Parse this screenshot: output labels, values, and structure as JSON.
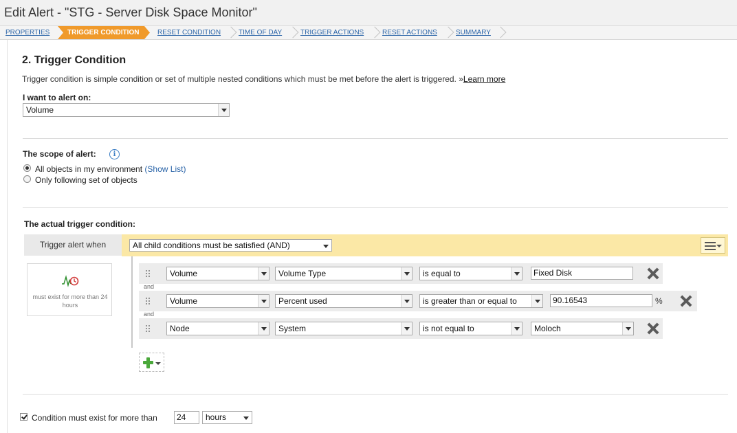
{
  "page_title": "Edit Alert - \"STG - Server Disk Space Monitor\"",
  "wizard_steps": [
    {
      "label": "PROPERTIES"
    },
    {
      "label": "TRIGGER CONDITION",
      "active": true
    },
    {
      "label": "RESET CONDITION"
    },
    {
      "label": "TIME OF DAY"
    },
    {
      "label": "TRIGGER ACTIONS"
    },
    {
      "label": "RESET ACTIONS"
    },
    {
      "label": "SUMMARY"
    }
  ],
  "section": {
    "title": "2. Trigger Condition",
    "description": "Trigger condition is simple condition or set of multiple nested conditions which must be met before the alert is triggered. »",
    "learn_more": "Learn more"
  },
  "alert_on": {
    "label": "I want to alert on:",
    "value": "Volume"
  },
  "scope": {
    "label": "The scope of alert:",
    "option_all": "All objects in my environment",
    "show_list": "(Show List)",
    "option_following": "Only following set of objects",
    "selected": "all"
  },
  "trigger": {
    "label": "The actual trigger condition:",
    "when_label": "Trigger alert when",
    "group_value": "All child conditions must be satisfied (AND)",
    "summary_text": "must exist for more than 24 hours",
    "conditions": [
      {
        "object": "Volume",
        "field": "Volume Type",
        "operator": "is equal to",
        "value": "Fixed Disk",
        "unit": ""
      },
      {
        "object": "Volume",
        "field": "Percent used",
        "operator": "is greater than or equal to",
        "value": "90.16543",
        "unit": "%"
      },
      {
        "object": "Node",
        "field": "System",
        "operator": "is not equal to",
        "value": "Moloch",
        "unit": ""
      }
    ],
    "joiner": "and"
  },
  "duration": {
    "label": "Condition must exist for more than",
    "checked": true,
    "value": "24",
    "unit": "hours"
  },
  "colors": {
    "active_step": "#f09a2b",
    "and_bar": "#fbe8a6",
    "add_icon": "#4aa83a",
    "link": "#2a64a8"
  }
}
